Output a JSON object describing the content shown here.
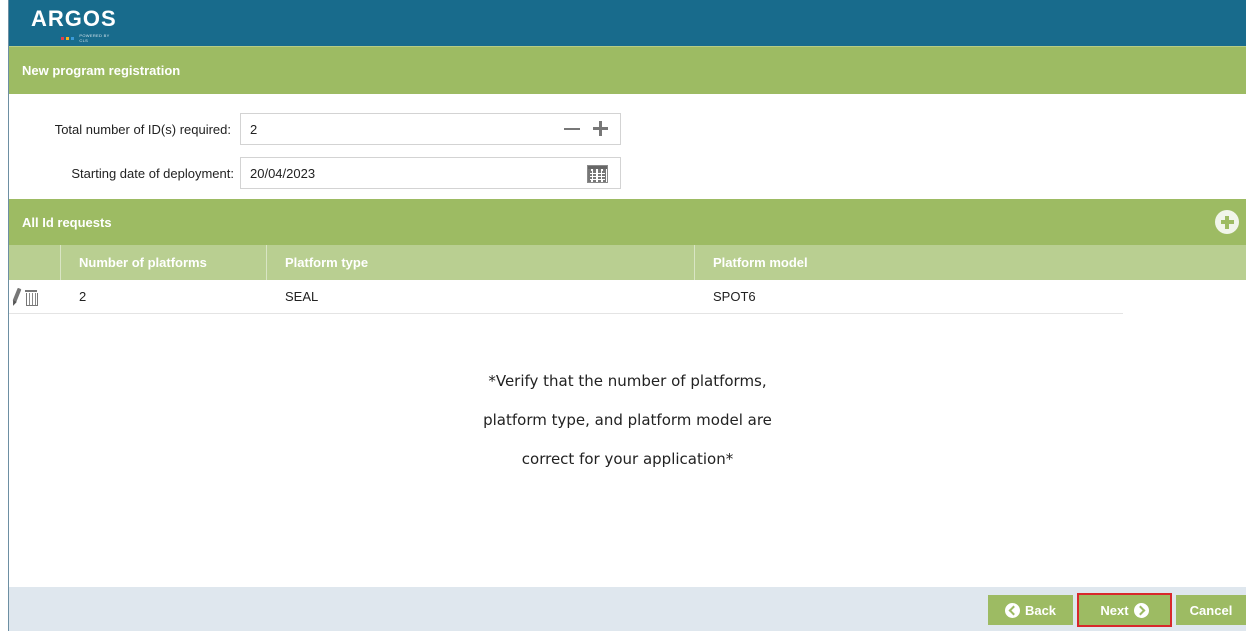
{
  "header": {
    "logo_text": "ARGOS",
    "logo_subtext": "POWERED BY CLS"
  },
  "page": {
    "title": "New program registration"
  },
  "form": {
    "total_ids_label": "Total number of ID(s) required:",
    "total_ids_value": "2",
    "start_date_label": "Starting date of deployment:",
    "start_date_value": "20/04/2023"
  },
  "id_requests": {
    "title": "All Id requests",
    "columns": [
      "Number of platforms",
      "Platform type",
      "Platform model"
    ],
    "rows": [
      {
        "number_of_platforms": "2",
        "platform_type": "SEAL",
        "platform_model": "SPOT6"
      }
    ]
  },
  "note": {
    "line1": "*Verify that the number of platforms,",
    "line2": "platform type, and platform model are",
    "line3": "correct for your application*"
  },
  "footer": {
    "back_label": "Back",
    "next_label": "Next",
    "cancel_label": "Cancel"
  },
  "icons": {
    "stepper_decrement": "minus-icon",
    "stepper_increment": "plus-icon",
    "date_picker": "calendar-icon",
    "add_request": "plus-circle-icon",
    "row_edit": "pencil-icon",
    "row_delete": "trash-icon",
    "back": "chevron-left-circle-icon",
    "next": "chevron-right-circle-icon"
  },
  "colors": {
    "brand_blue": "#186b8c",
    "section_green": "#9dbb63",
    "table_header_green": "#b9cf91",
    "footer_bg": "#dfe7ee",
    "highlight_red": "#d8282c"
  }
}
